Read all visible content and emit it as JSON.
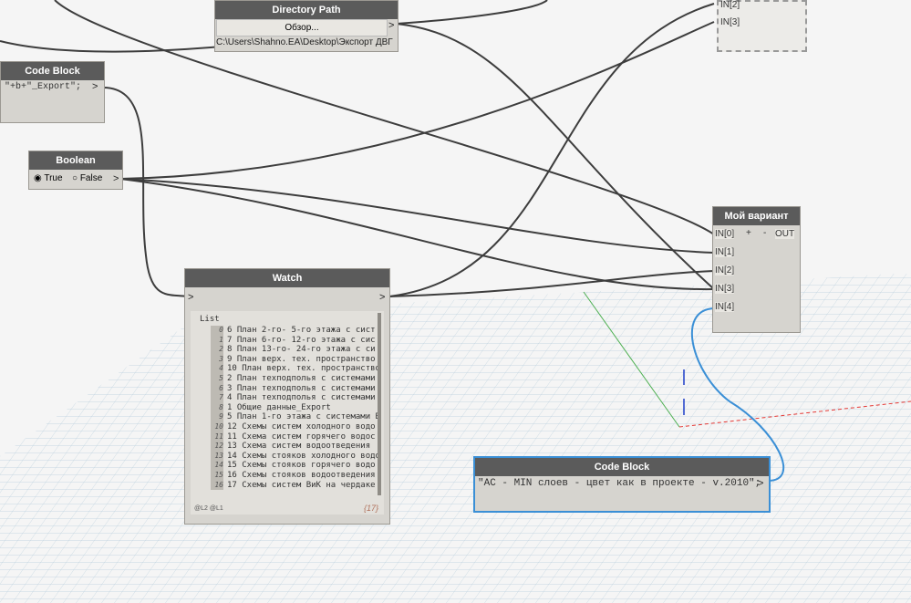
{
  "nodes": {
    "directory_path": {
      "title": "Directory Path",
      "browse_label": "Обзор...",
      "output_port": ">",
      "path_value": "C:\\Users\\Shahno.EA\\Desktop\\Экспорт ДВГ"
    },
    "code_block_top": {
      "title": "Code Block",
      "code": "\"+b+\"_Export\";",
      "output_port": ">"
    },
    "boolean": {
      "title": "Boolean",
      "true_label": "True",
      "false_label": "False",
      "selected": "True",
      "output_port": ">"
    },
    "watch": {
      "title": "Watch",
      "input_port": ">",
      "output_port": ">",
      "list_header": "List",
      "items": [
        {
          "i": "0",
          "text": "6 План 2-го- 5-го  этажа с сист"
        },
        {
          "i": "1",
          "text": "7 План 6-го- 12-го  этажа с сис"
        },
        {
          "i": "2",
          "text": "8 План 13-го- 24-го  этажа с си"
        },
        {
          "i": "3",
          "text": "9 План верх. тех. пространство "
        },
        {
          "i": "4",
          "text": "10 План верх. тех. пространство"
        },
        {
          "i": "5",
          "text": "2 План техподполья с системами "
        },
        {
          "i": "6",
          "text": "3 План техподполья с системами "
        },
        {
          "i": "7",
          "text": "4 План техподполья с системами "
        },
        {
          "i": "8",
          "text": "1 Общие данные_Export"
        },
        {
          "i": "9",
          "text": "5 План 1-го этажа с системами В"
        },
        {
          "i": "10",
          "text": "12 Схемы систем холодного водо"
        },
        {
          "i": "11",
          "text": "11 Схема систем горячего водос"
        },
        {
          "i": "12",
          "text": "13 Схема систем водоотведения "
        },
        {
          "i": "13",
          "text": "14 Схемы стояков холодного водо"
        },
        {
          "i": "14",
          "text": "15 Схемы стояков горячего водо"
        },
        {
          "i": "15",
          "text": "16 Схемы стояков водоотведения"
        },
        {
          "i": "16",
          "text": "17 Схемы систем ВиК на чердаке"
        }
      ],
      "levels": "@L2 @L1",
      "count": "{17}"
    },
    "my_variant": {
      "title": "Мой вариант",
      "inputs": [
        "IN[0]",
        "IN[1]",
        "IN[2]",
        "IN[3]",
        "IN[4]"
      ],
      "plus": "+",
      "minus": "-",
      "output": "OUT"
    },
    "top_right_partial": {
      "inputs": [
        "IN[2]",
        "IN[3]"
      ]
    },
    "code_block_bottom": {
      "title": "Code Block",
      "code": "\"АС - MIN слоев - цвет как в проекте - v.2010\";",
      "output_port": ">"
    }
  },
  "colors": {
    "node_header": "#5b5b5b",
    "node_body": "#d6d4cf",
    "wire": "#3d3d3d",
    "selected_wire": "#3a8fd6",
    "grid": "#a7c3d6"
  }
}
